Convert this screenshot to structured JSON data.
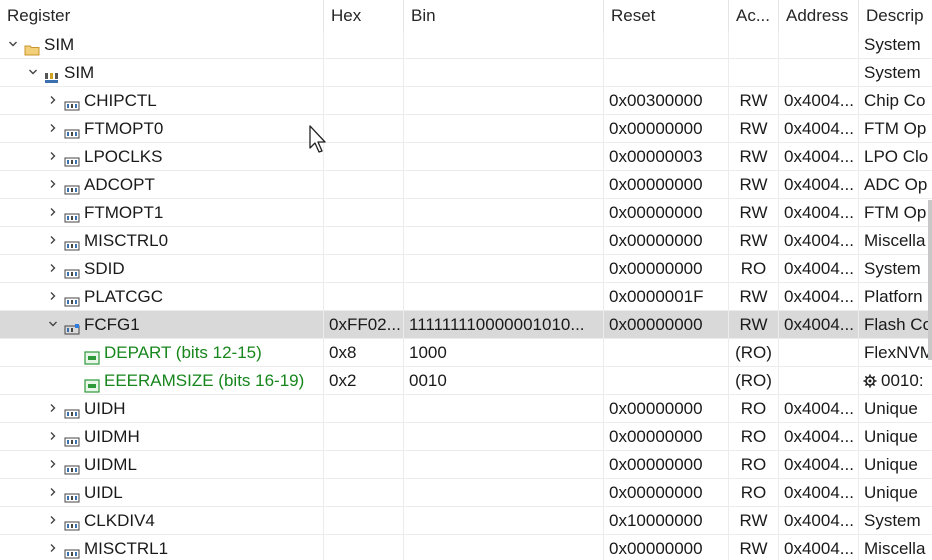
{
  "columns": [
    "Register",
    "Hex",
    "Bin",
    "Reset",
    "Ac...",
    "Address",
    "Descrip"
  ],
  "rows": [
    {
      "name": "SIM",
      "icon": "folder-icon",
      "level": 0,
      "twisty": "down",
      "hex": "",
      "bin": "",
      "reset": "",
      "access": "",
      "address": "",
      "desc": "System",
      "green": false,
      "selected": false
    },
    {
      "name": "SIM",
      "icon": "peripheral-icon",
      "level": 1,
      "twisty": "down",
      "hex": "",
      "bin": "",
      "reset": "",
      "access": "",
      "address": "",
      "desc": "System",
      "green": false,
      "selected": false
    },
    {
      "name": "CHIPCTL",
      "icon": "register-icon",
      "level": 2,
      "twisty": "right",
      "hex": "",
      "bin": "",
      "reset": "0x00300000",
      "access": "RW",
      "address": "0x4004...",
      "desc": "Chip Co",
      "green": false,
      "selected": false
    },
    {
      "name": "FTMOPT0",
      "icon": "register-icon",
      "level": 2,
      "twisty": "right",
      "hex": "",
      "bin": "",
      "reset": "0x00000000",
      "access": "RW",
      "address": "0x4004...",
      "desc": "FTM Op",
      "green": false,
      "selected": false
    },
    {
      "name": "LPOCLKS",
      "icon": "register-icon",
      "level": 2,
      "twisty": "right",
      "hex": "",
      "bin": "",
      "reset": "0x00000003",
      "access": "RW",
      "address": "0x4004...",
      "desc": "LPO Clo",
      "green": false,
      "selected": false
    },
    {
      "name": "ADCOPT",
      "icon": "register-icon",
      "level": 2,
      "twisty": "right",
      "hex": "",
      "bin": "",
      "reset": "0x00000000",
      "access": "RW",
      "address": "0x4004...",
      "desc": "ADC Op",
      "green": false,
      "selected": false
    },
    {
      "name": "FTMOPT1",
      "icon": "register-icon",
      "level": 2,
      "twisty": "right",
      "hex": "",
      "bin": "",
      "reset": "0x00000000",
      "access": "RW",
      "address": "0x4004...",
      "desc": "FTM Op",
      "green": false,
      "selected": false
    },
    {
      "name": "MISCTRL0",
      "icon": "register-icon",
      "level": 2,
      "twisty": "right",
      "hex": "",
      "bin": "",
      "reset": "0x00000000",
      "access": "RW",
      "address": "0x4004...",
      "desc": "Miscella",
      "green": false,
      "selected": false
    },
    {
      "name": "SDID",
      "icon": "register-icon",
      "level": 2,
      "twisty": "right",
      "hex": "",
      "bin": "",
      "reset": "0x00000000",
      "access": "RO",
      "address": "0x4004...",
      "desc": "System",
      "green": false,
      "selected": false
    },
    {
      "name": "PLATCGC",
      "icon": "register-icon",
      "level": 2,
      "twisty": "right",
      "hex": "",
      "bin": "",
      "reset": "0x0000001F",
      "access": "RW",
      "address": "0x4004...",
      "desc": "Platforn",
      "green": false,
      "selected": false
    },
    {
      "name": "FCFG1",
      "icon": "register-active-icon",
      "level": 2,
      "twisty": "down",
      "hex": "0xFF02...",
      "bin": "111111110000001010...",
      "reset": "0x00000000",
      "access": "RW",
      "address": "0x4004...",
      "desc": "Flash Co",
      "green": false,
      "selected": true
    },
    {
      "name": "DEPART (bits 12-15)",
      "icon": "field-icon",
      "level": 3,
      "twisty": "none",
      "hex": "0x8",
      "bin": "1000",
      "reset": "",
      "access": "(RO)",
      "address": "",
      "desc": "FlexNVM",
      "green": true,
      "selected": false
    },
    {
      "name": "EEERAMSIZE (bits 16-19)",
      "icon": "field-icon",
      "level": 3,
      "twisty": "none",
      "hex": "0x2",
      "bin": "0010",
      "reset": "",
      "access": "(RO)",
      "address": "",
      "desc": "0010:",
      "desc_icon": "gear-icon",
      "green": true,
      "selected": false
    },
    {
      "name": "UIDH",
      "icon": "register-icon",
      "level": 2,
      "twisty": "right",
      "hex": "",
      "bin": "",
      "reset": "0x00000000",
      "access": "RO",
      "address": "0x4004...",
      "desc": "Unique",
      "green": false,
      "selected": false
    },
    {
      "name": "UIDMH",
      "icon": "register-icon",
      "level": 2,
      "twisty": "right",
      "hex": "",
      "bin": "",
      "reset": "0x00000000",
      "access": "RO",
      "address": "0x4004...",
      "desc": "Unique",
      "green": false,
      "selected": false
    },
    {
      "name": "UIDML",
      "icon": "register-icon",
      "level": 2,
      "twisty": "right",
      "hex": "",
      "bin": "",
      "reset": "0x00000000",
      "access": "RO",
      "address": "0x4004...",
      "desc": "Unique",
      "green": false,
      "selected": false
    },
    {
      "name": "UIDL",
      "icon": "register-icon",
      "level": 2,
      "twisty": "right",
      "hex": "",
      "bin": "",
      "reset": "0x00000000",
      "access": "RO",
      "address": "0x4004...",
      "desc": "Unique",
      "green": false,
      "selected": false
    },
    {
      "name": "CLKDIV4",
      "icon": "register-icon",
      "level": 2,
      "twisty": "right",
      "hex": "",
      "bin": "",
      "reset": "0x10000000",
      "access": "RW",
      "address": "0x4004...",
      "desc": "System",
      "green": false,
      "selected": false
    },
    {
      "name": "MISCTRL1",
      "icon": "register-icon",
      "level": 2,
      "twisty": "right",
      "hex": "",
      "bin": "",
      "reset": "0x00000000",
      "access": "RW",
      "address": "0x4004...",
      "desc": "Miscella",
      "green": false,
      "selected": false
    }
  ],
  "colors": {
    "green_text": "#17861d",
    "selected_row": "#d9d9d9",
    "folder": "#e8b44a",
    "icon_blue": "#3a6fb0"
  }
}
